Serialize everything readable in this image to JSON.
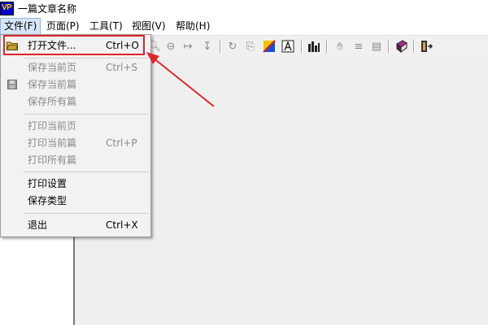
{
  "window": {
    "icon_text": "VP",
    "title": "一篇文章名称"
  },
  "menubar": {
    "items": [
      "文件(F)",
      "页面(P)",
      "工具(T)",
      "视图(V)",
      "帮助(H)"
    ]
  },
  "toolbar": {
    "icons": [
      "zoom-in-icon",
      "zoom-out-icon",
      "fit-width-icon",
      "fit-height-icon",
      "rotate-icon",
      "copy-icon",
      "color-icon",
      "text-icon",
      "chart-icon",
      "hand-icon",
      "notes-icon",
      "page-icon",
      "book-icon",
      "exit-icon"
    ]
  },
  "file_menu": {
    "items": [
      {
        "label": "打开文件...",
        "shortcut": "Ctrl+O",
        "enabled": true,
        "icon": "folder-icon"
      },
      {
        "label": "保存当前页",
        "shortcut": "Ctrl+S",
        "enabled": false
      },
      {
        "label": "保存当前篇",
        "shortcut": "",
        "enabled": false,
        "icon": "save-icon"
      },
      {
        "label": "保存所有篇",
        "shortcut": "",
        "enabled": false
      },
      {
        "label": "打印当前页",
        "shortcut": "",
        "enabled": false
      },
      {
        "label": "打印当前篇",
        "shortcut": "Ctrl+P",
        "enabled": false
      },
      {
        "label": "打印所有篇",
        "shortcut": "",
        "enabled": false
      },
      {
        "label": "打印设置",
        "shortcut": "",
        "enabled": true
      },
      {
        "label": "保存类型",
        "shortcut": "",
        "enabled": true
      },
      {
        "label": "退出",
        "shortcut": "Ctrl+X",
        "enabled": true
      }
    ]
  },
  "annotation": {
    "color": "#e0252b"
  }
}
